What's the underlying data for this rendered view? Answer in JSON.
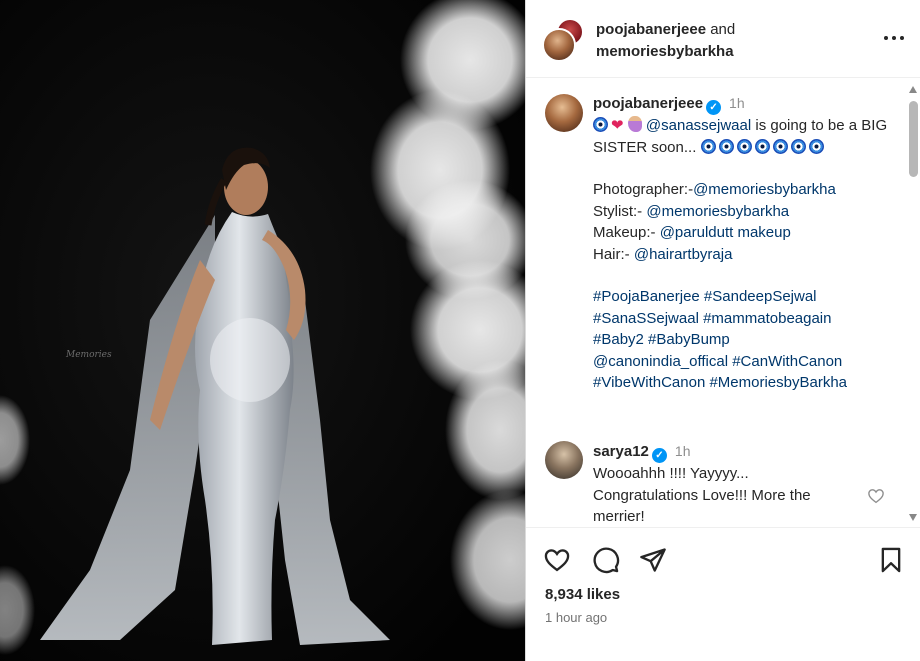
{
  "header": {
    "user1": "poojabanerjeee",
    "joiner": "and",
    "user2": "memoriesbybarkha"
  },
  "caption": {
    "username": "poojabanerjeee",
    "time": "1h",
    "mention": "@sanassejwaal",
    "line1_text": "is going to be a BIG SISTER soon...",
    "credits": [
      {
        "label": "Photographer:-",
        "handle": "@memoriesbybarkha"
      },
      {
        "label": "Stylist:- ",
        "handle": "@memoriesbybarkha"
      },
      {
        "label": "Makeup:- ",
        "handle": "@paruldutt makeup"
      },
      {
        "label": "Hair:- ",
        "handle": "@hairartbyraja"
      }
    ],
    "hashtags_l1": "#PoojaBanerjee #SandeepSejwal",
    "hashtags_l2": "#SanaSSejwaal #mammatobeagain",
    "hashtags_l3": "#Baby2 #BabyBump",
    "hashtags_l4": "@canonindia_offical #CanWithCanon",
    "hashtags_l5": "#VibeWithCanon #MemoriesbyBarkha"
  },
  "comment": {
    "username": "sarya12",
    "time": "1h",
    "text_l1": "Woooahhh !!!! Yayyyy...",
    "text_l2": "Congratulations Love!!! More the",
    "text_l3": "merrier!"
  },
  "stats": {
    "likes": "8,934 likes",
    "posted": "1 hour ago"
  },
  "photo": {
    "watermark": "Memories"
  },
  "icons": [
    "heart-icon",
    "comment-icon",
    "share-icon",
    "bookmark-icon",
    "more-icon",
    "verified-icon"
  ],
  "colors": {
    "link": "#00376b",
    "verified": "#0095f6",
    "muted": "#8e8e8e"
  }
}
